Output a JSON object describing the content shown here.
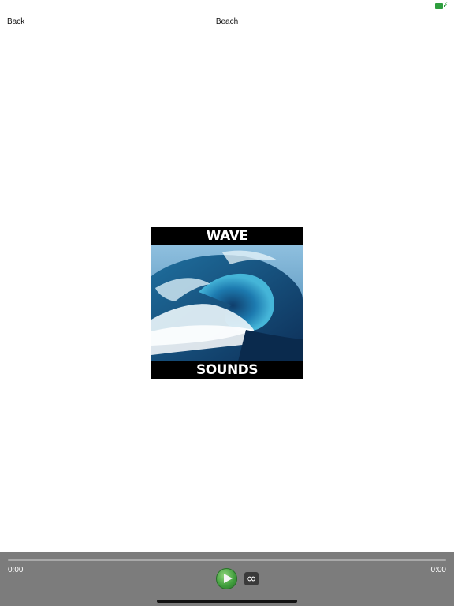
{
  "status_bar": {
    "battery_icon": "battery-charging-icon",
    "battery_color": "#2e9e3e"
  },
  "nav": {
    "back_label": "Back",
    "title": "Beach"
  },
  "artwork": {
    "top_text": "WAVE",
    "bottom_text": "SOUNDS",
    "image": "ocean-wave-image"
  },
  "player": {
    "current_time": "0:00",
    "total_time": "0:00",
    "progress": 0,
    "play_icon": "play-icon",
    "loop_icon": "infinity-loop-icon",
    "loop_glyph": "∞",
    "bar_color": "#7c7c7c",
    "play_color": "#3f9d3c"
  }
}
